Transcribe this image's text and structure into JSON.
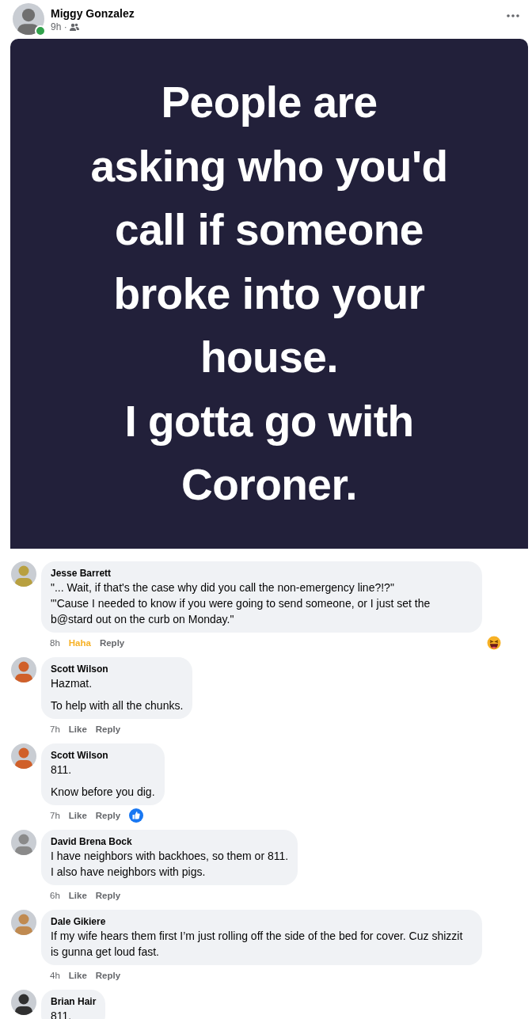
{
  "post": {
    "author": "Miggy Gonzalez",
    "online": true,
    "time": "9h ·",
    "image_lines": [
      "People are",
      "asking who you'd",
      "call if someone",
      "broke into your",
      "house.",
      "I gotta go with",
      "Coroner."
    ]
  },
  "comments": [
    {
      "author": "Jesse Barrett",
      "paragraphs": [
        "\"... Wait, if that's the case why did you call the non-emergency line?!?\"\n\"'Cause I needed to know if you were going to send someone, or I just set the b@stard out on the curb on Monday.\""
      ],
      "time": "8h",
      "reaction_label": "Haha",
      "reacted": true,
      "reply": "Reply",
      "reaction": {
        "kind": "haha"
      }
    },
    {
      "author": "Scott Wilson",
      "paragraphs": [
        "Hazmat.",
        "To help with all the chunks."
      ],
      "time": "7h",
      "reaction_label": "Like",
      "reacted": false,
      "reply": "Reply"
    },
    {
      "author": "Scott Wilson",
      "paragraphs": [
        "811.",
        "Know before you dig."
      ],
      "time": "7h",
      "reaction_label": "Like",
      "reacted": false,
      "reply": "Reply",
      "reaction": {
        "kind": "like"
      }
    },
    {
      "author": "David Brena Bock",
      "paragraphs": [
        "I have neighbors with backhoes, so them or 811.\nI also have neighbors with pigs."
      ],
      "time": "6h",
      "reaction_label": "Like",
      "reacted": false,
      "reply": "Reply"
    },
    {
      "author": "Dale Gikiere",
      "paragraphs": [
        "If my wife hears them first I’m just rolling off the side of the bed for cover. Cuz shizzit is gunna get loud fast."
      ],
      "time": "4h",
      "reaction_label": "Like",
      "reacted": false,
      "reply": "Reply"
    },
    {
      "author": "Brian Hair",
      "paragraphs": [
        "811."
      ]
    }
  ]
}
